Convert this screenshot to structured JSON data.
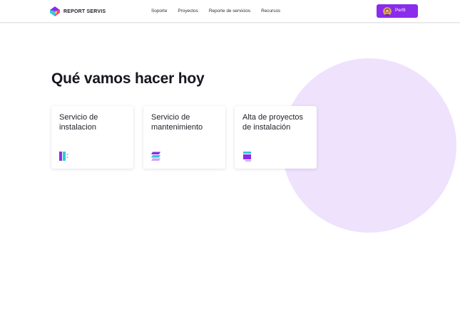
{
  "header": {
    "brand_name": "REPORT SERVIS",
    "nav": [
      {
        "label": "Soporte"
      },
      {
        "label": "Proyectos"
      },
      {
        "label": "Reporte de servicios"
      },
      {
        "label": "Recursos"
      }
    ],
    "profile_label": "Perfil"
  },
  "hero": {
    "title": "Qué vamos hacer hoy"
  },
  "cards": [
    {
      "title": "Servicio de instalacion",
      "icon": "columns-icon"
    },
    {
      "title": "Servicio de mantenimiento",
      "icon": "stack-layers-icon"
    },
    {
      "title": "Alta de proyectos de instalación",
      "icon": "add-layer-icon"
    }
  ],
  "colors": {
    "accent": "#8b2bec",
    "circle_bg": "#efe2fd",
    "icon_purple": "#8b2bec",
    "icon_light": "#c9a6f7",
    "icon_teal": "#35c9d6"
  }
}
